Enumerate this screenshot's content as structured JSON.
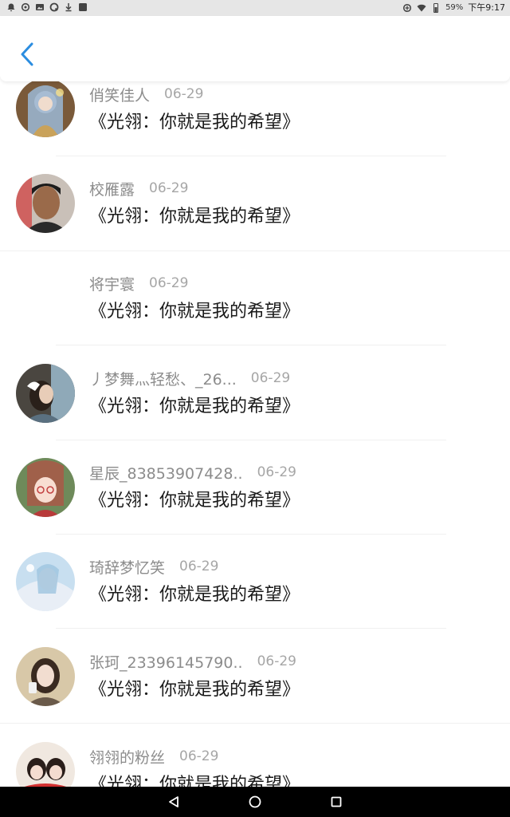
{
  "status_bar": {
    "left_icons": [
      "bell-icon",
      "sync-icon",
      "image-icon",
      "qq-icon",
      "download-icon",
      "square-icon"
    ],
    "battery": "59%",
    "time": "下午9:17"
  },
  "header": {
    "back_icon": "chevron-left-icon"
  },
  "accent_color": "#2b8de0",
  "list": {
    "items": [
      {
        "name": "俏笑佳人",
        "date": "06-29",
        "title": "《光翎：你就是我的希望》",
        "avatar": "avatar-image"
      },
      {
        "name": "校雁露",
        "date": "06-29",
        "title": "《光翎：你就是我的希望》",
        "avatar": "avatar-image"
      },
      {
        "name": "将宇寰",
        "date": "06-29",
        "title": "《光翎：你就是我的希望》",
        "avatar": "none"
      },
      {
        "name": "丿梦舞灬轻愁、_26...",
        "date": "06-29",
        "title": "《光翎：你就是我的希望》",
        "avatar": "avatar-image"
      },
      {
        "name": "星辰_83853907428..",
        "date": "06-29",
        "title": "《光翎：你就是我的希望》",
        "avatar": "avatar-image"
      },
      {
        "name": "琦辞梦忆笑",
        "date": "06-29",
        "title": "《光翎：你就是我的希望》",
        "avatar": "avatar-image"
      },
      {
        "name": "张珂_23396145790..",
        "date": "06-29",
        "title": "《光翎：你就是我的希望》",
        "avatar": "avatar-image"
      },
      {
        "name": "翎翎的粉丝",
        "date": "06-29",
        "title": "《光翎：你就是我的希望》",
        "avatar": "avatar-image"
      }
    ]
  },
  "nav_bar": {
    "buttons": [
      "back-triangle-icon",
      "home-circle-icon",
      "recents-square-icon"
    ]
  }
}
